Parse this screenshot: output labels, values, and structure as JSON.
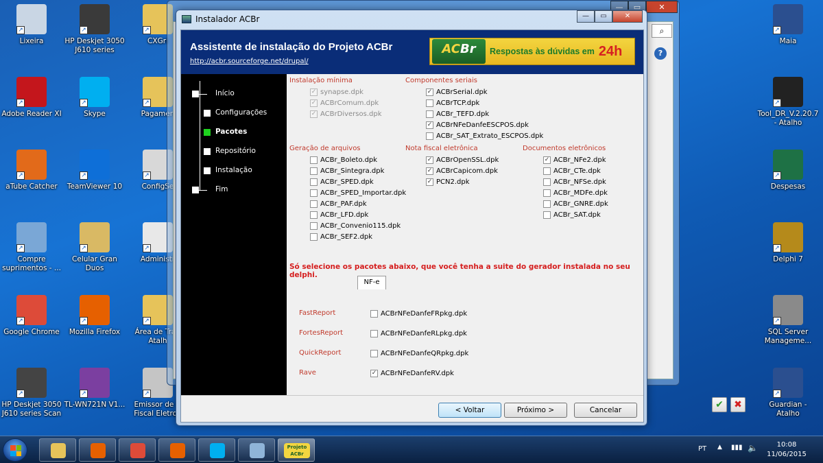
{
  "desktop_left": [
    {
      "label": "Lixeira",
      "icon": "recycle-bin-icon",
      "color": "#c9d6e4"
    },
    {
      "label": "HP Deskjet 3050 J610 series",
      "icon": "printer-icon",
      "color": "#3a3a3a"
    },
    {
      "label": "CXGri",
      "icon": "folder-icon",
      "color": "#e6c35a"
    },
    {
      "label": "Adobe Reader XI",
      "icon": "adobe-reader-icon",
      "color": "#c4161c"
    },
    {
      "label": "Skype",
      "icon": "skype-icon",
      "color": "#00aff0"
    },
    {
      "label": "Pagamen",
      "icon": "folder-icon",
      "color": "#e6c35a"
    },
    {
      "label": "aTube Catcher",
      "icon": "atube-catcher-icon",
      "color": "#e26a1a"
    },
    {
      "label": "TeamViewer 10",
      "icon": "teamviewer-icon",
      "color": "#0e6fd8"
    },
    {
      "label": "ConfigSe",
      "icon": "config-icon",
      "color": "#d8d8d8"
    },
    {
      "label": "Compre suprimentos - ...",
      "icon": "printer-shop-icon",
      "color": "#7aa7d6"
    },
    {
      "label": "Celular Gran Duos",
      "icon": "folder-zip-icon",
      "color": "#d9b964"
    },
    {
      "label": "Administr",
      "icon": "admin-icon",
      "color": "#e8e8e8"
    },
    {
      "label": "Google Chrome",
      "icon": "chrome-icon",
      "color": "#dd4b39"
    },
    {
      "label": "Mozilla Firefox",
      "icon": "firefox-icon",
      "color": "#e66000"
    },
    {
      "label": "Área de Tra - Atalh",
      "icon": "folder-icon",
      "color": "#e6c35a"
    },
    {
      "label": "HP Deskjet 3050 J610 series Scan",
      "icon": "scanner-icon",
      "color": "#444"
    },
    {
      "label": "TL-WN721N V1...",
      "icon": "winrar-icon",
      "color": "#7b3fa0"
    },
    {
      "label": "Emissor de N Fiscal Eletron",
      "icon": "nfe-icon",
      "color": "#c5c5c5"
    }
  ],
  "desktop_right": [
    {
      "label": "Maia",
      "icon": "maia-icon",
      "color": "#2b4f8f"
    },
    {
      "label": "Tool_DR_V.2.20.7 - Atalho",
      "icon": "urmet-icon",
      "color": "#222"
    },
    {
      "label": "Despesas",
      "icon": "excel-icon",
      "color": "#1e7145"
    },
    {
      "label": "Delphi 7",
      "icon": "delphi-icon",
      "color": "#b58a1b"
    },
    {
      "label": "SQL Server Manageme...",
      "icon": "sql-server-icon",
      "color": "#8a8a8a"
    },
    {
      "label": "Guardian - Atalho",
      "icon": "guardian-icon",
      "color": "#2b4f8f"
    }
  ],
  "window": {
    "title": "Instalador ACBr",
    "min": "—",
    "max": "▭",
    "close": "✕"
  },
  "header": {
    "title": "Assistente de instalação do Projeto ACBr",
    "link": "http://acbr.sourceforge.net/drupal/",
    "banner_logo_a": "AC",
    "banner_logo_b": "Br",
    "banner_slogan": "Respostas às dúvidas em",
    "banner_24h": "24h"
  },
  "steps": [
    {
      "label": "Início"
    },
    {
      "label": "Configurações"
    },
    {
      "label": "Pacotes",
      "active": true
    },
    {
      "label": "Repositório"
    },
    {
      "label": "Instalação"
    },
    {
      "label": "Fim"
    }
  ],
  "groups": {
    "minima": {
      "title": "Instalação mínima",
      "items": [
        {
          "label": "synapse.dpk",
          "checked": true,
          "disabled": true
        },
        {
          "label": "ACBrComum.dpk",
          "checked": true,
          "disabled": true
        },
        {
          "label": "ACBrDiversos.dpk",
          "checked": true,
          "disabled": true
        }
      ]
    },
    "seriais": {
      "title": "Componentes seriais",
      "items": [
        {
          "label": "ACBrSerial.dpk",
          "checked": true
        },
        {
          "label": "ACBrTCP.dpk",
          "checked": false
        },
        {
          "label": "ACBr_TEFD.dpk",
          "checked": false
        },
        {
          "label": "ACBrNFeDanfeESCPOS.dpk",
          "checked": true
        },
        {
          "label": "ACBr_SAT_Extrato_ESCPOS.dpk",
          "checked": false
        }
      ]
    },
    "arquivos": {
      "title": "Geração de arquivos",
      "items": [
        {
          "label": "ACBr_Boleto.dpk",
          "checked": false
        },
        {
          "label": "ACBr_Sintegra.dpk",
          "checked": false
        },
        {
          "label": "ACBr_SPED.dpk",
          "checked": false
        },
        {
          "label": "ACBr_SPED_Importar.dpk",
          "checked": false
        },
        {
          "label": "ACBr_PAF.dpk",
          "checked": false
        },
        {
          "label": "ACBr_LFD.dpk",
          "checked": false
        },
        {
          "label": "ACBr_Convenio115.dpk",
          "checked": false
        },
        {
          "label": "ACBr_SEF2.dpk",
          "checked": false
        }
      ]
    },
    "nfe": {
      "title": "Nota fiscal eletrônica",
      "items": [
        {
          "label": "ACBrOpenSSL.dpk",
          "checked": true
        },
        {
          "label": "ACBrCapicom.dpk",
          "checked": true
        },
        {
          "label": "PCN2.dpk",
          "checked": true
        }
      ]
    },
    "docs": {
      "title": "Documentos eletrônicos",
      "items": [
        {
          "label": "ACBr_NFe2.dpk",
          "checked": true
        },
        {
          "label": "ACBr_CTe.dpk",
          "checked": false
        },
        {
          "label": "ACBr_NFSe.dpk",
          "checked": false
        },
        {
          "label": "ACBr_MDFe.dpk",
          "checked": false
        },
        {
          "label": "ACBr_GNRE.dpk",
          "checked": false
        },
        {
          "label": "ACBr_SAT.dpk",
          "checked": false
        }
      ]
    }
  },
  "warning": "Só selecione os pacotes abaixo, que você tenha a suite do gerador instalada no seu delphi.",
  "tab_label": "NF-e",
  "reports": [
    {
      "name": "FastReport",
      "package": "ACBrNFeDanfeFRpkg.dpk",
      "checked": false
    },
    {
      "name": "FortesReport",
      "package": "ACBrNFeDanfeRLpkg.dpk",
      "checked": false
    },
    {
      "name": "QuickReport",
      "package": "ACBrNFeDanfeQRpkg.dpk",
      "checked": false
    },
    {
      "name": "Rave",
      "package": "ACBrNFeDanfeRV.dpk",
      "checked": true
    }
  ],
  "buttons": {
    "ok_glyph": "✔",
    "cancel_glyph": "✖",
    "back": "< Voltar",
    "next": "Próximo >",
    "cancel": "Cancelar"
  },
  "taskbar": {
    "language": "PT",
    "time": "10:08",
    "date": "11/06/2015",
    "apps": [
      {
        "name": "explorer-icon",
        "color": "#e6c35a"
      },
      {
        "name": "media-player-icon",
        "color": "#e66000"
      },
      {
        "name": "chrome-icon",
        "color": "#dd4b39"
      },
      {
        "name": "firefox-icon",
        "color": "#e66000"
      },
      {
        "name": "skype-icon",
        "color": "#00aff0"
      },
      {
        "name": "paint-icon",
        "color": "#8fb4d8"
      },
      {
        "name": "acbr-project-icon",
        "color": "#f3d540",
        "label": "Projeto ACBr",
        "active": true
      }
    ]
  },
  "bg_window": {
    "search_glyph": "⌕",
    "help_glyph": "?"
  }
}
